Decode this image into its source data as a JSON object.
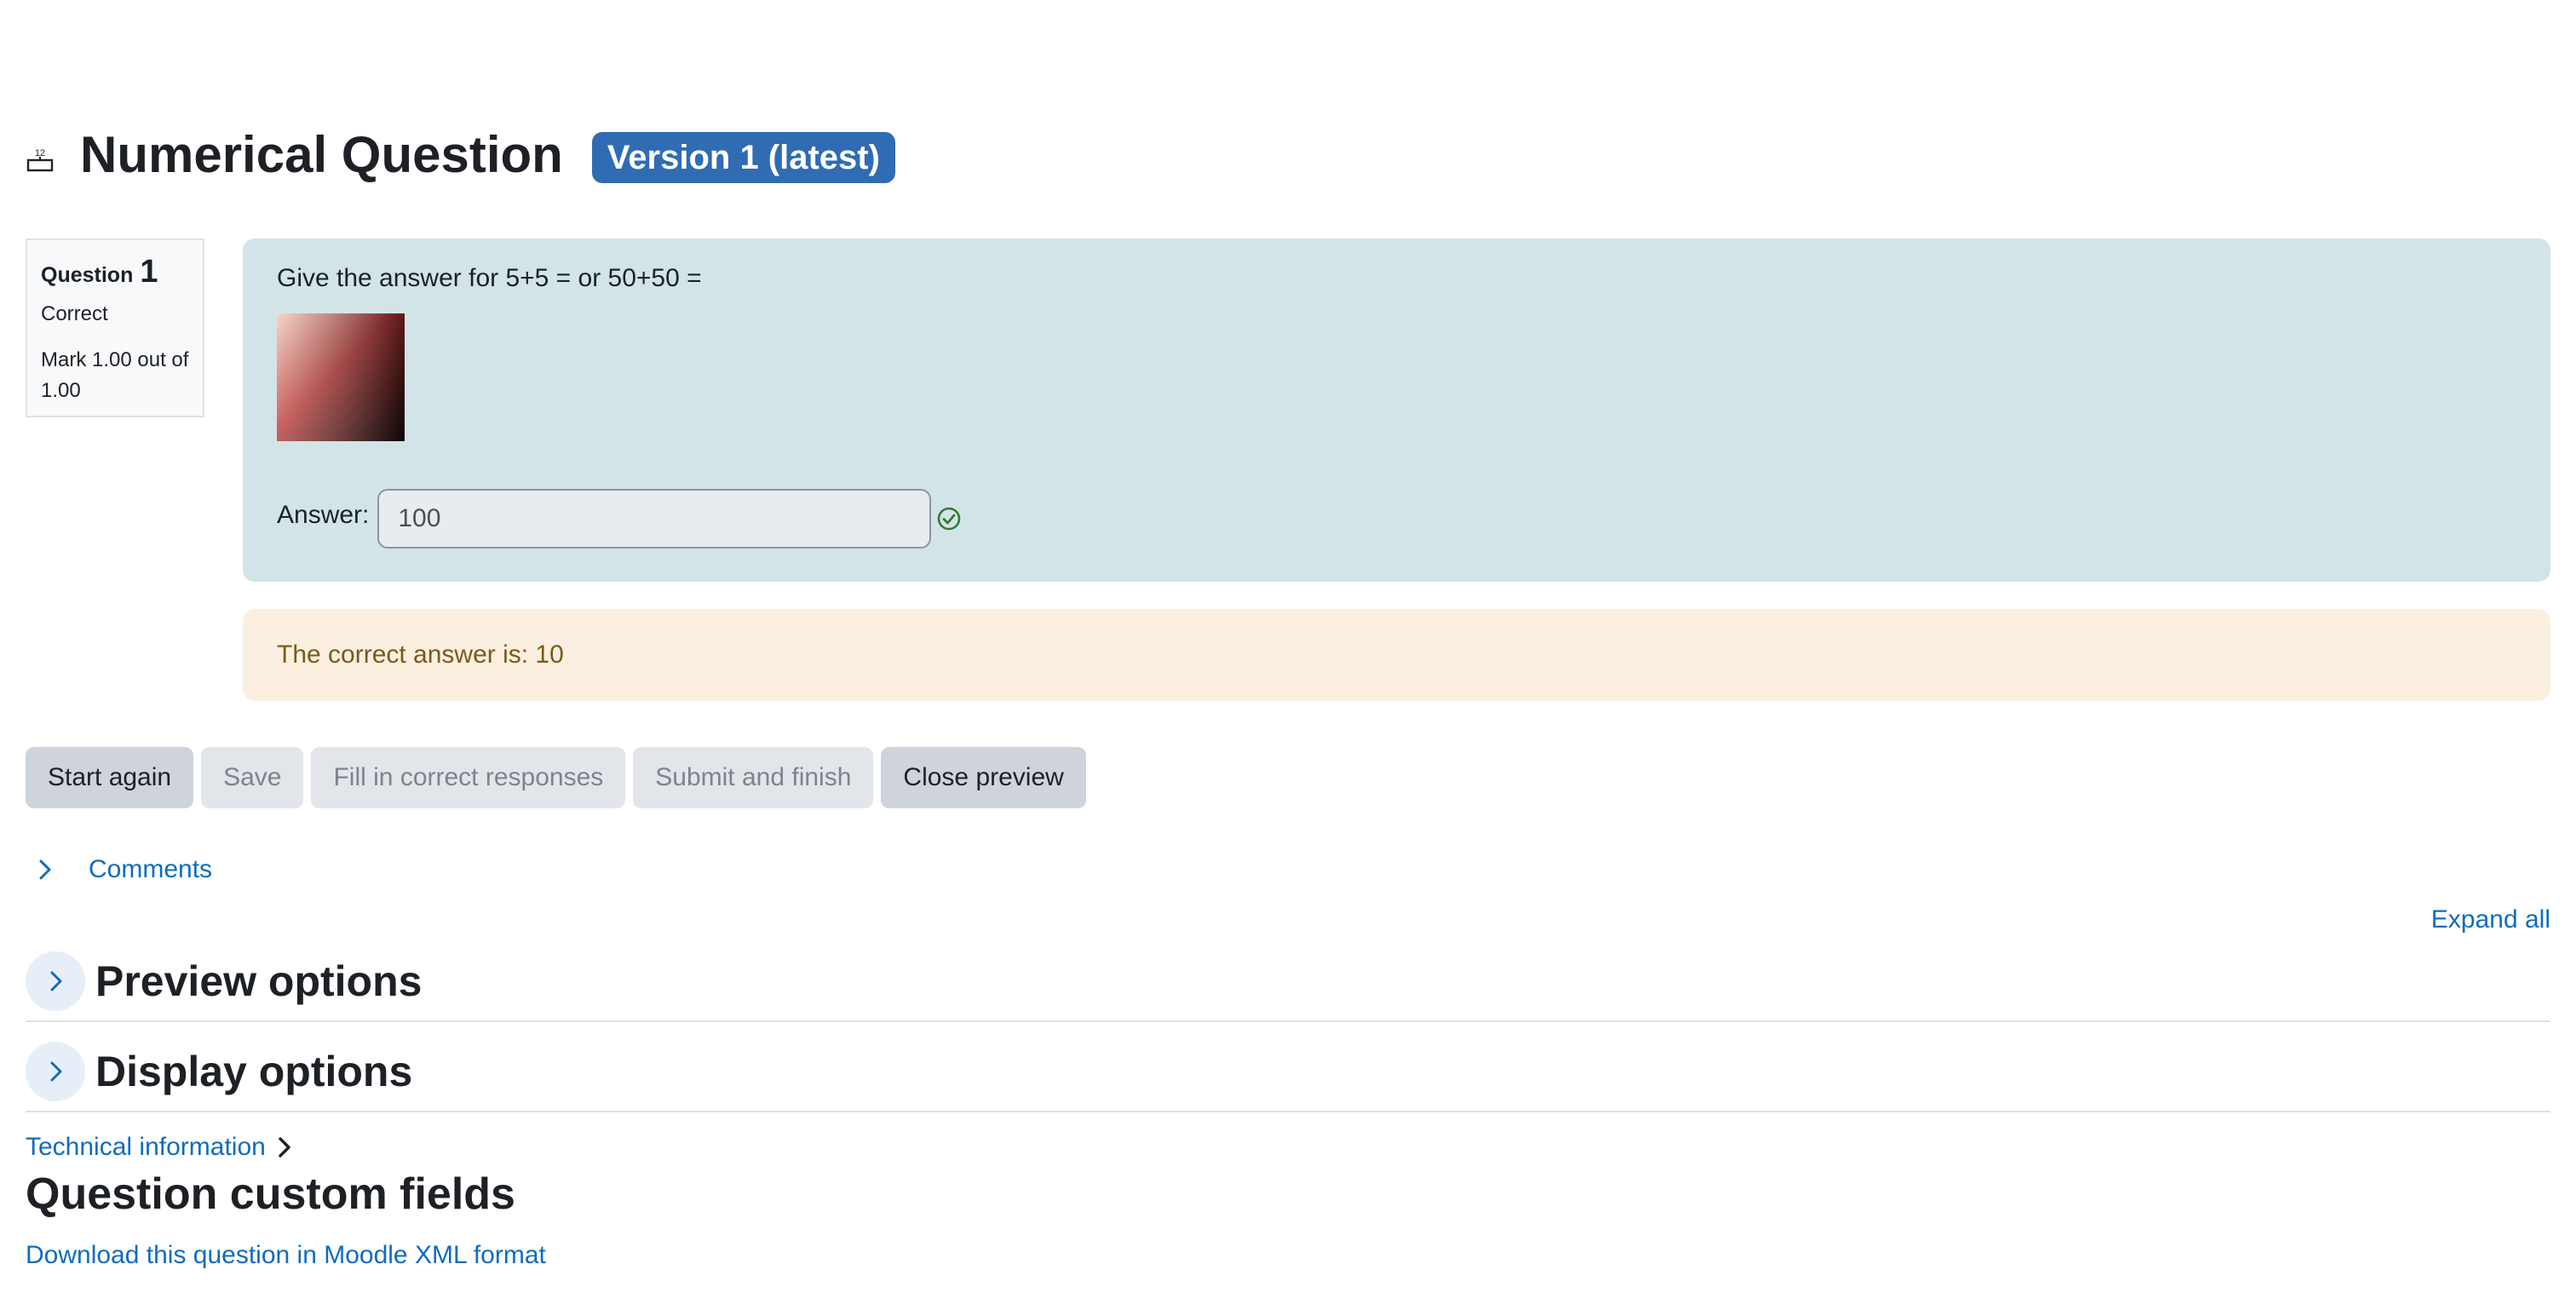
{
  "header": {
    "title": "Numerical Question",
    "version_badge": "Version 1 (latest)",
    "qtype_icon": "numerical-question-icon"
  },
  "question_info": {
    "label": "Question",
    "number": "1",
    "state": "Correct",
    "grade": "Mark 1.00 out of 1.00"
  },
  "formulation": {
    "question_text": "Give the answer for 5+5 = or 50+50 =",
    "image_icon": "gradient-image",
    "answer_label": "Answer:",
    "answer_value": "100",
    "feedback_icon": "correct-check-icon"
  },
  "outcome": {
    "right_answer": "The correct answer is: 10"
  },
  "buttons": {
    "start_again": "Start again",
    "save": "Save",
    "fill_correct": "Fill in correct responses",
    "submit_finish": "Submit and finish",
    "close_preview": "Close preview"
  },
  "comments": {
    "label": "Comments"
  },
  "expand_all": "Expand all",
  "sections": {
    "preview_options": "Preview options",
    "display_options": "Display options"
  },
  "technical_info": "Technical information",
  "custom_fields_title": "Question custom fields",
  "download_link": "Download this question in Moodle XML format",
  "colors": {
    "accent": "#0f6cbf",
    "badge": "#2f6cb3",
    "formulation_bg": "#d2e4e8",
    "outcome_bg": "#fbefdf",
    "correct": "#357a32"
  }
}
